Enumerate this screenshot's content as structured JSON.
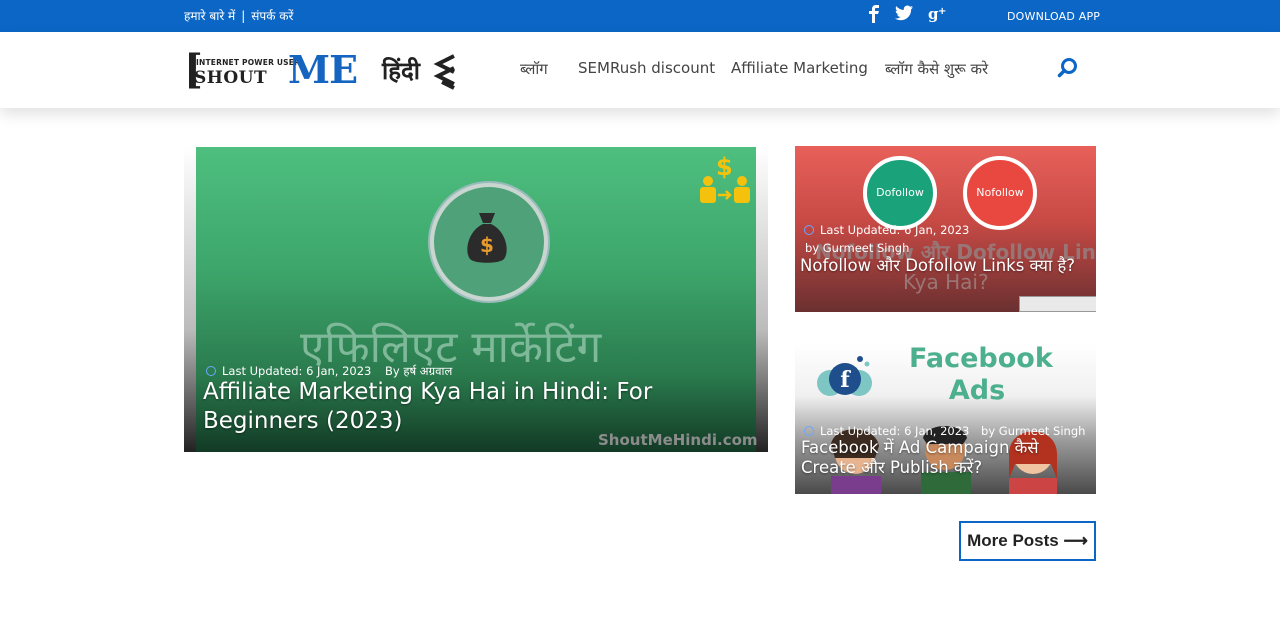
{
  "topbar": {
    "about": "हमारे बारे में",
    "separator": "|",
    "contact": "संपर्क करें",
    "download": "DOWNLOAD APP"
  },
  "logo": {
    "tagline": "INTERNET POWER USER",
    "shout": "SHOUT",
    "me": "ME",
    "hindi": "हिंदी"
  },
  "nav": {
    "items": [
      "ब्लॉग",
      "SEMRush discount",
      "Affiliate Marketing",
      "ब्लॉग कैसे शुरू करे"
    ]
  },
  "posts": [
    {
      "image_text": "एफिलिएट मार्केटिंग",
      "watermark": "ShoutMeHindi.com",
      "updated": "Last Updated: 6 Jan, 2023",
      "by": "By",
      "author": "हर्ष अग्रवाल",
      "title": "Affiliate Marketing Kya Hai in Hindi: For Beginners (2023)"
    },
    {
      "badge1": "Dofollow",
      "badge2": "Nofollow",
      "image_text": "Nofollow और Dofollow Links",
      "image_text2": "Kya Hai?",
      "updated": "Last Updated: 6 Jan, 2023",
      "by": "by",
      "author": "Gurmeet Singh",
      "title": "Nofollow और Dofollow Links क्या है?"
    },
    {
      "image_text": "Facebook Ads",
      "updated": "Last Updated: 6 Jan, 2023",
      "by": "by",
      "author": "Gurmeet Singh",
      "title": "Facebook में Ad Campaign कैसे Create और Publish करें?"
    }
  ],
  "more_posts": "More Posts ⟶",
  "colors": {
    "topbar": "#0b66c6",
    "accent": "#1565c0"
  }
}
